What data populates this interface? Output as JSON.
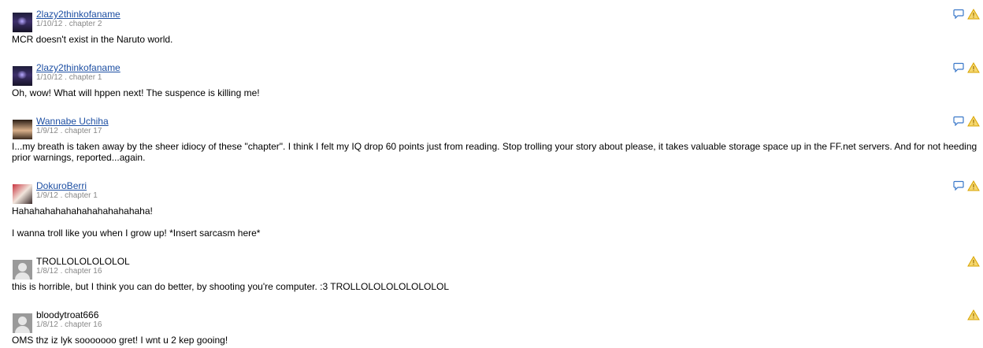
{
  "reviews": [
    {
      "author": "2lazy2thinkofaname",
      "date": "1/10/12",
      "chapter": "chapter 2",
      "paragraphs": [
        "MCR doesn't exist in the Naruto world."
      ],
      "avatar_icon": "user-avatar",
      "reply_icon": "reply-speech-bubble-icon",
      "report_icon": "report-warning-icon"
    },
    {
      "author": "2lazy2thinkofaname",
      "date": "1/10/12",
      "chapter": "chapter 1",
      "paragraphs": [
        "Oh, wow! What will hppen next! The suspence is killing me!"
      ],
      "avatar_icon": "user-avatar",
      "reply_icon": "reply-speech-bubble-icon",
      "report_icon": "report-warning-icon"
    },
    {
      "author": "Wannabe Uchiha",
      "date": "1/9/12",
      "chapter": "chapter 17",
      "paragraphs": [
        "I...my breath is taken away by the sheer idiocy of these \"chapter\". I think I felt my IQ drop 60 points just from reading. Stop trolling your story about please, it takes valuable storage space up in the FF.net servers. And for not heeding prior warnings, reported...again."
      ],
      "avatar_icon": "user-avatar",
      "reply_icon": "reply-speech-bubble-icon",
      "report_icon": "report-warning-icon"
    },
    {
      "author": "DokuroBerri",
      "date": "1/9/12",
      "chapter": "chapter 1",
      "paragraphs": [
        "Hahahahahahahahahahahahaha!",
        "I wanna troll like you when I grow up! *Insert sarcasm here*"
      ],
      "avatar_icon": "user-avatar",
      "reply_icon": "reply-speech-bubble-icon",
      "report_icon": "report-warning-icon"
    },
    {
      "author": "TROLLOLOLOLOLOL",
      "date": "1/8/12",
      "chapter": "chapter 16",
      "paragraphs": [
        "this is horrible, but I think you can do better, by shooting you're computer. :3 TROLLOLOLOLOLOLOLOL"
      ],
      "avatar_icon": "default-user-avatar",
      "report_icon": "report-warning-icon"
    },
    {
      "author": "bloodytroat666",
      "date": "1/8/12",
      "chapter": "chapter 16",
      "paragraphs": [
        "OMS thz iz lyk sooooooo gret! I wnt u 2 kep gooing!"
      ],
      "avatar_icon": "default-user-avatar",
      "report_icon": "report-warning-icon"
    }
  ],
  "separator": " . ",
  "colors": {
    "link": "#1d4fa3",
    "meta": "#888888",
    "reply_icon": "#3a78c9",
    "warning_fill": "#f5d76e",
    "warning_stroke": "#d8a300"
  }
}
